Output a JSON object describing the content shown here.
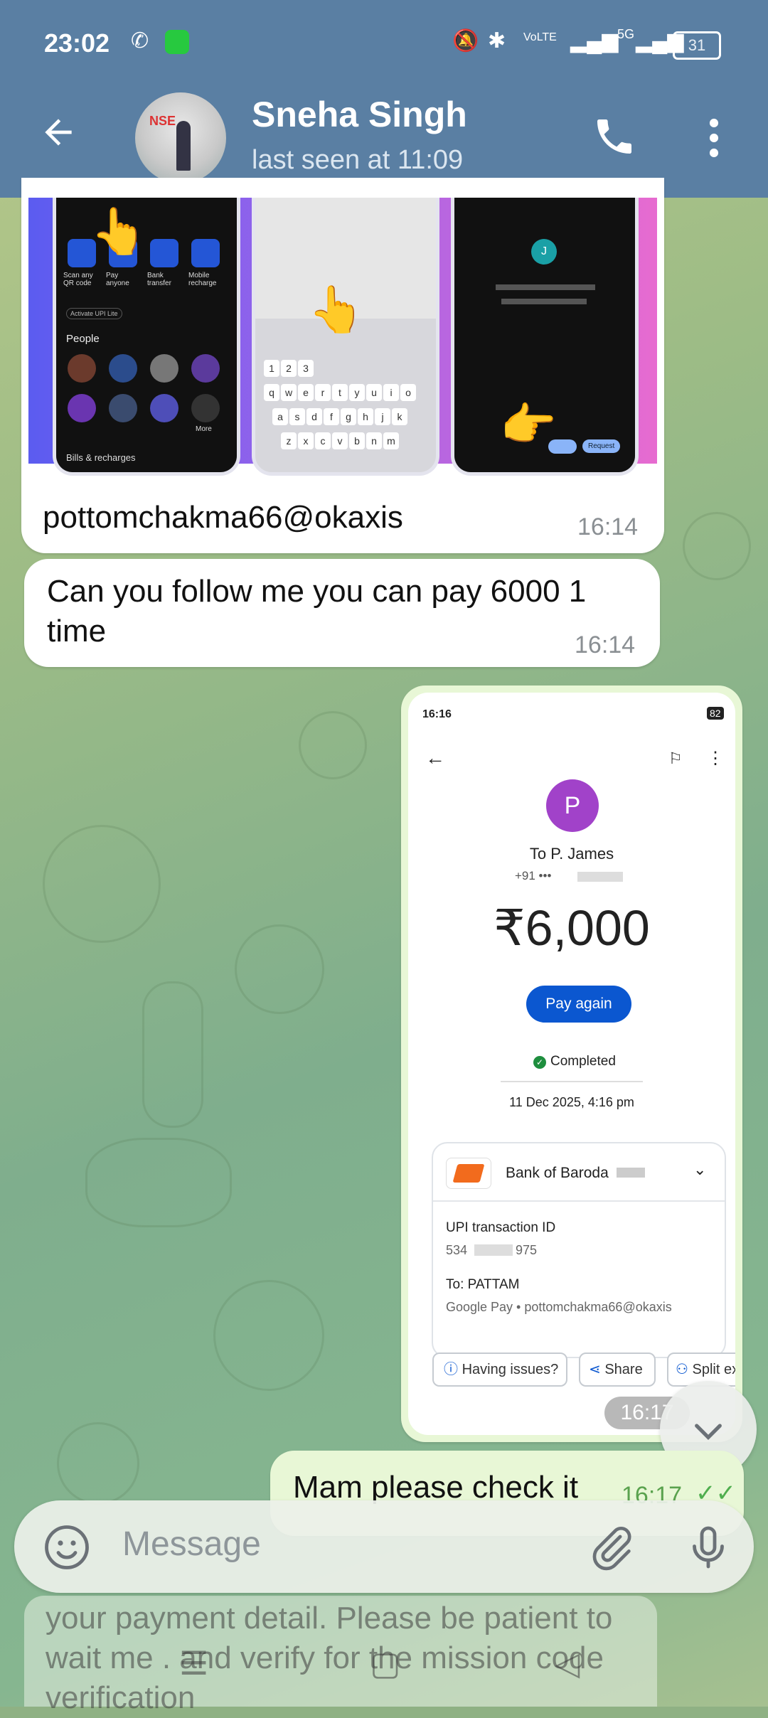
{
  "status_bar": {
    "time": "23:02",
    "net1": "VoLTE",
    "net2": "5G",
    "battery": "31"
  },
  "header": {
    "contact_name": "Sneha Singh",
    "last_seen": "last seen at 11:09",
    "avatar_text": "NSE"
  },
  "messages": {
    "m1": {
      "caption": "pottomchakma66@okaxis",
      "time": "16:14",
      "thumb": {
        "scan": "Scan any QR code",
        "pay": "Pay anyone",
        "bank": "Bank transfer",
        "mobile": "Mobile recharge",
        "people": "People",
        "more": "More",
        "bills": "Bills & recharges",
        "activate": "Activate UPI Lite",
        "request": "Request"
      }
    },
    "m2": {
      "text": "Can you follow me you can pay 6000 1 time",
      "time": "16:14"
    },
    "m3": {
      "time": "16:17",
      "gpay": {
        "status_time": "16:16",
        "battery": "82",
        "avatar_letter": "P",
        "to_name": "To P. James",
        "phone": "+91 ••• ",
        "amount": "₹6,000",
        "pay_again": "Pay again",
        "status": "Completed",
        "datetime": "11 Dec 2025, 4:16 pm",
        "bank": "Bank of Baroda",
        "txn_label": "UPI transaction ID",
        "txn_id": "534",
        "txn_tail": "975",
        "to_label": "To: PATTAM",
        "to_detail": "Google Pay • pottomchakma66@okaxis",
        "chips": [
          "Having issues?",
          "Share",
          "Split ex"
        ]
      }
    },
    "m4": {
      "text": "Mam please check it",
      "time": "16:17"
    },
    "m5": {
      "text": "your payment detail. Please be patient to wait me . and verify for the mission code verification"
    }
  },
  "input": {
    "placeholder": "Message"
  },
  "colors": {
    "header": "#5a7fa3",
    "outgoing": "#e8f7d6",
    "gpay_blue": "#0b57d0",
    "completed": "#1e8e3e"
  },
  "icons": [
    "back-arrow-icon",
    "phone-call-icon",
    "more-vert-icon",
    "emoji-icon",
    "attach-icon",
    "mic-icon",
    "chevron-down-icon",
    "double-check-icon"
  ]
}
